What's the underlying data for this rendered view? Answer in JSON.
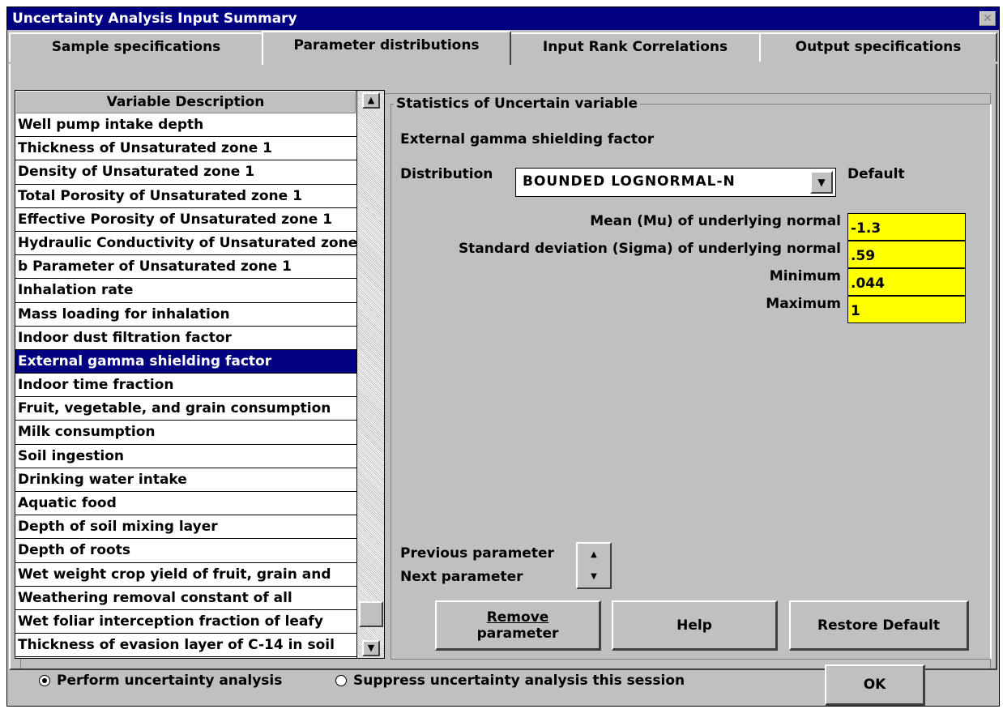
{
  "window": {
    "title": "Uncertainty Analysis Input Summary",
    "close_glyph": "✕"
  },
  "tabs": [
    {
      "label": "Sample specifications"
    },
    {
      "label": "Parameter distributions"
    },
    {
      "label": "Input Rank Correlations"
    },
    {
      "label": "Output specifications"
    }
  ],
  "list": {
    "header": "Variable Description",
    "items": [
      "Well pump intake depth",
      "Thickness of Unsaturated zone  1",
      "Density of Unsaturated zone  1",
      "Total  Porosity of Unsaturated zone  1",
      "Effective Porosity of Unsaturated zone  1",
      "Hydraulic Conductivity of Unsaturated zone",
      "b Parameter of Unsaturated zone  1",
      "Inhalation rate",
      "Mass loading for inhalation",
      "Indoor dust filtration factor",
      "External gamma shielding factor",
      "Indoor time fraction",
      "Fruit, vegetable, and grain consumption",
      "Milk consumption",
      "Soil ingestion",
      "Drinking water intake",
      "Aquatic food",
      "Depth of soil mixing layer",
      "Depth of roots",
      "Wet weight crop yield of fruit, grain and",
      "Weathering removal constant  of all",
      "Wet foliar interception fraction of leafy",
      "Thickness of evasion layer of C-14 in soil"
    ],
    "selected_index": 10
  },
  "stats": {
    "group_title": "Statistics of Uncertain variable",
    "parameter_name": "External gamma shielding factor",
    "distribution_label": "Distribution",
    "distribution_value": "BOUNDED LOGNORMAL-N",
    "default_label": "Default",
    "fields": [
      {
        "label": "Mean (Mu) of underlying normal",
        "value": "-1.3"
      },
      {
        "label": "Standard deviation (Sigma) of underlying normal",
        "value": ".59"
      },
      {
        "label": "Minimum",
        "value": ".044"
      },
      {
        "label": "Maximum",
        "value": "1"
      }
    ],
    "previous_label": "Previous parameter",
    "next_label": "Next parameter"
  },
  "buttons": {
    "remove_line1": "Remove",
    "remove_line2": "parameter",
    "help": "Help",
    "restore_default": "Restore Default",
    "ok": "OK"
  },
  "options": {
    "perform": "Perform uncertainty analysis",
    "suppress": "Suppress uncertainty analysis this session",
    "selected": "perform"
  },
  "colors": {
    "title_bar": "#000080",
    "selection": "#000080",
    "field_bg": "#ffff00",
    "face": "#c0c0c0"
  },
  "icons": [
    "close-icon",
    "scroll-up-icon",
    "scroll-down-icon",
    "dropdown-arrow-icon",
    "spin-up-icon",
    "spin-down-icon",
    "radio-icon"
  ]
}
